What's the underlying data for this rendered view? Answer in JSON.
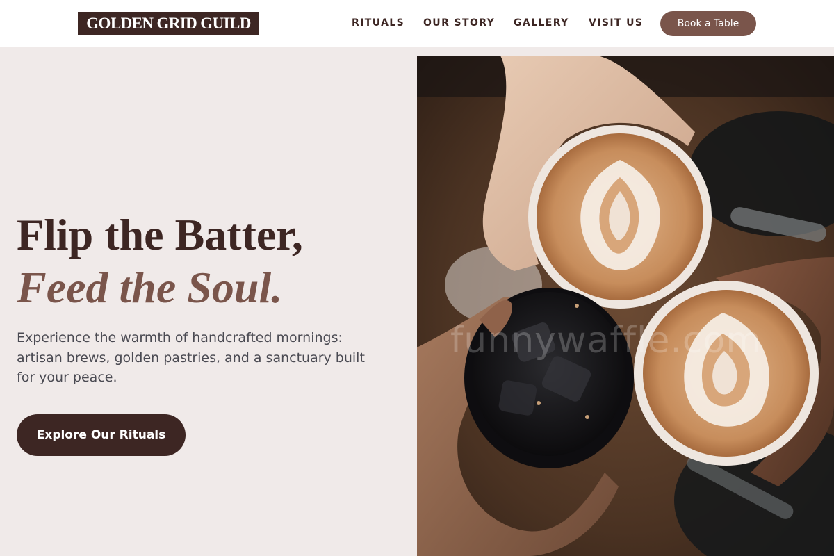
{
  "brand": {
    "name": "GOLDEN GRID GUILD"
  },
  "nav": {
    "items": [
      {
        "label": "RITUALS"
      },
      {
        "label": "OUR STORY"
      },
      {
        "label": "GALLERY"
      },
      {
        "label": "VISIT US"
      }
    ],
    "cta_label": "Book a Table"
  },
  "hero": {
    "title_line1": "Flip the Batter,",
    "title_line2": "Feed the Soul.",
    "subtitle": "Experience the warmth of handcrafted mornings: artisan brews, golden pastries, and a sanctuary built for your peace.",
    "cta_label": "Explore Our Rituals"
  },
  "image": {
    "subject": "three-coffee-cups-toast",
    "watermark": "funnywaffle.com"
  },
  "colors": {
    "brand_dark": "#3d2623",
    "accent": "#7a554b",
    "hero_bg": "#f0eae9",
    "header_bg": "#ffffff"
  }
}
